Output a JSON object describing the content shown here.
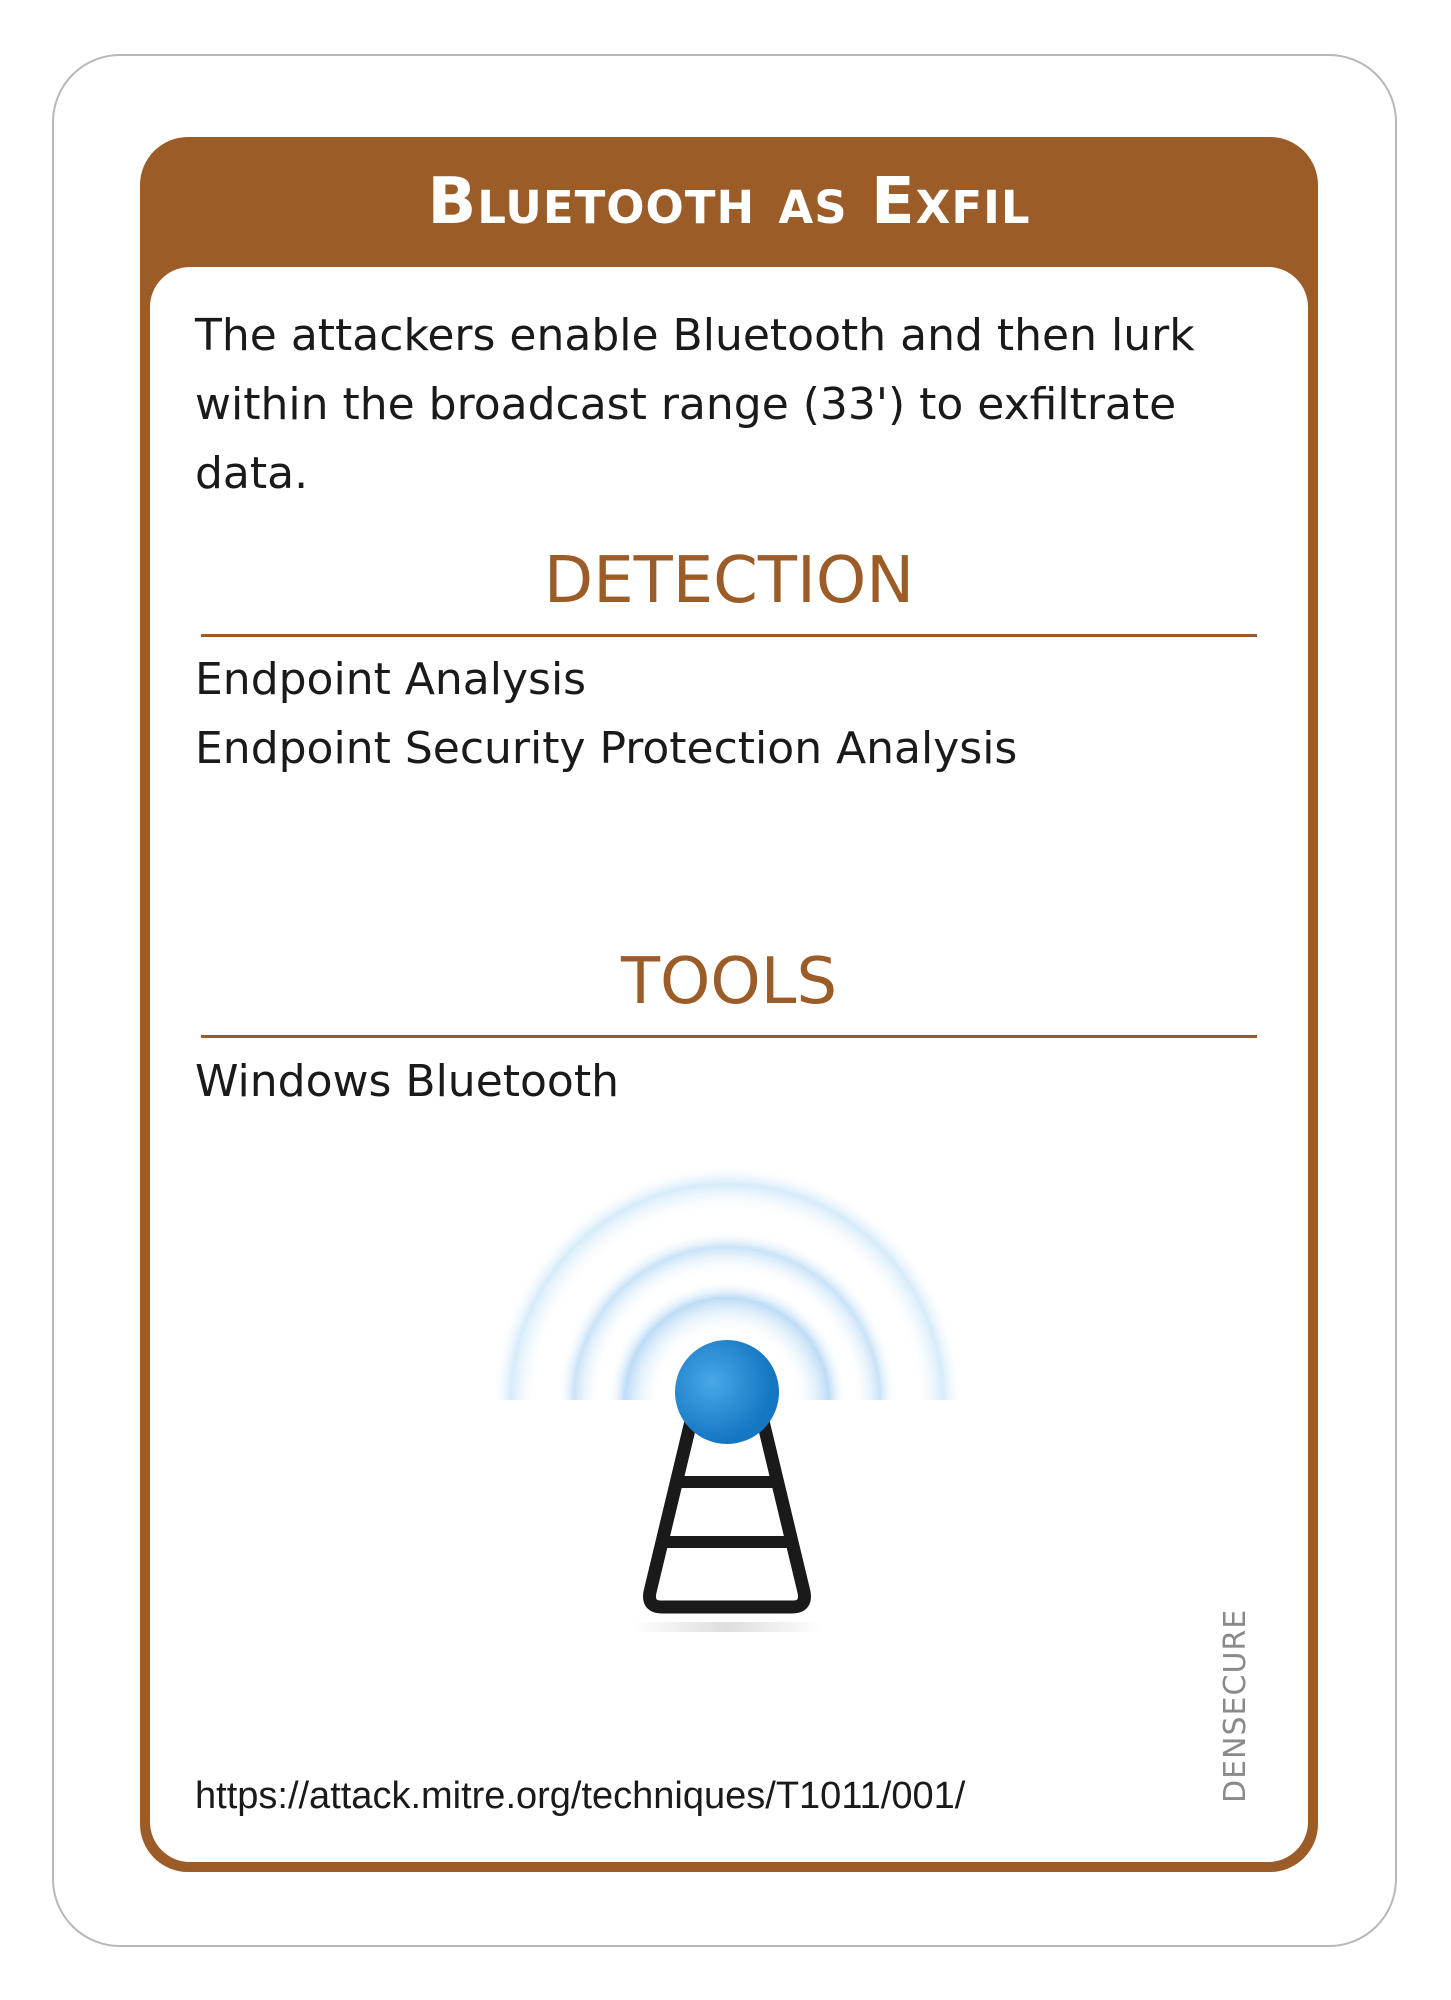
{
  "card": {
    "title": "Bluetooth as Exfil",
    "description_lines": [
      "The attackers enable Bluetooth and then lurk",
      "within the broadcast range (33') to exfiltrate data."
    ],
    "detection": {
      "heading": "DETECTION",
      "items": [
        "Endpoint Analysis",
        "Endpoint Security Protection Analysis"
      ]
    },
    "tools": {
      "heading": "TOOLS",
      "items": [
        "Windows Bluetooth"
      ]
    },
    "icon": "broadcast-tower-icon",
    "url": "https://attack.mitre.org/techniques/T1011/001/",
    "brand": "DENSECURE"
  },
  "colors": {
    "accent": "#9c5c28",
    "icon_blue": "#1e88d0",
    "icon_dark": "#1a1a1a",
    "signal_light": "#d6ebfa"
  }
}
